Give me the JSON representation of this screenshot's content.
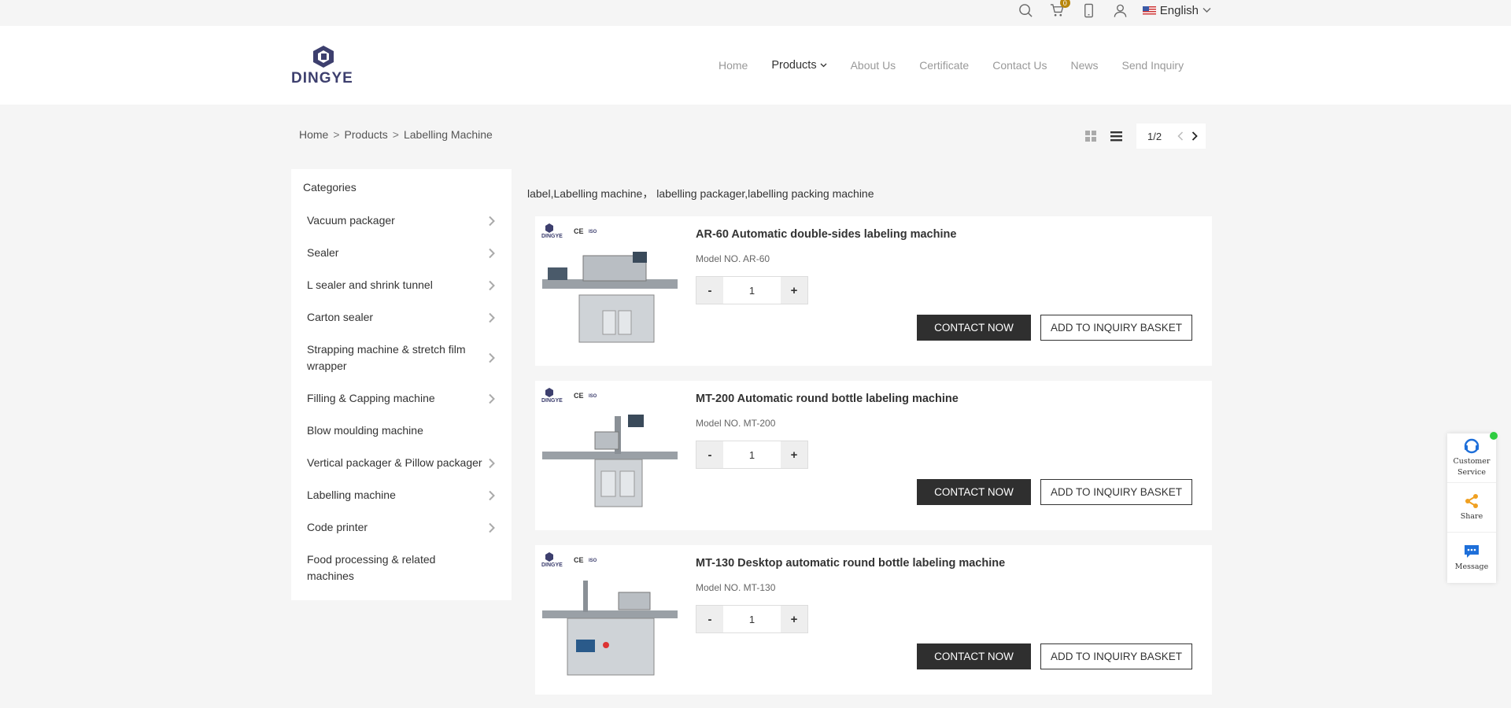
{
  "topbar": {
    "cart_count": "0",
    "language": "English"
  },
  "logo": {
    "text": "DINGYE"
  },
  "nav": {
    "items": [
      {
        "label": "Home"
      },
      {
        "label": "Products"
      },
      {
        "label": "About Us"
      },
      {
        "label": "Certificate"
      },
      {
        "label": "Contact Us"
      },
      {
        "label": "News"
      },
      {
        "label": "Send Inquiry"
      }
    ]
  },
  "breadcrumb": {
    "items": [
      "Home",
      "Products",
      "Labelling Machine"
    ],
    "separator": ">"
  },
  "pager": {
    "text": "1/2"
  },
  "sidebar": {
    "title": "Categories",
    "items": [
      "Vacuum packager",
      "Sealer",
      "L sealer and shrink tunnel",
      "Carton sealer",
      "Strapping machine & stretch film wrapper",
      "Filling & Capping machine",
      "Blow moulding machine",
      "Vertical packager & Pillow packager",
      "Labelling machine",
      "Code printer",
      "Food processing & related machines"
    ]
  },
  "tagline": "label,Labelling machine， labelling packager,labelling packing machine",
  "products": [
    {
      "title": "AR-60 Automatic double-sides labeling machine",
      "model": "Model NO. AR-60",
      "qty": "1"
    },
    {
      "title": "MT-200 Automatic round bottle labeling machine",
      "model": "Model NO. MT-200",
      "qty": "1"
    },
    {
      "title": "MT-130 Desktop automatic round bottle labeling machine",
      "model": "Model NO. MT-130",
      "qty": "1"
    }
  ],
  "product_buttons": {
    "minus": "-",
    "plus": "+",
    "contact": "CONTACT NOW",
    "basket": "ADD TO INQUIRY BASKET"
  },
  "product_image": {
    "brand": "DINGYE",
    "ce": "CE",
    "iso": "ISO"
  },
  "float_widget": {
    "service_line1": "Customer",
    "service_line2": "Service",
    "share": "Share",
    "message": "Message"
  },
  "colors": {
    "accent_dark": "#2f2f2f",
    "logo": "#3d3f6e",
    "badge": "#b8860b",
    "online": "#2ecc40",
    "share_icon": "#f0a020",
    "service_icon": "#1e6fd9"
  }
}
